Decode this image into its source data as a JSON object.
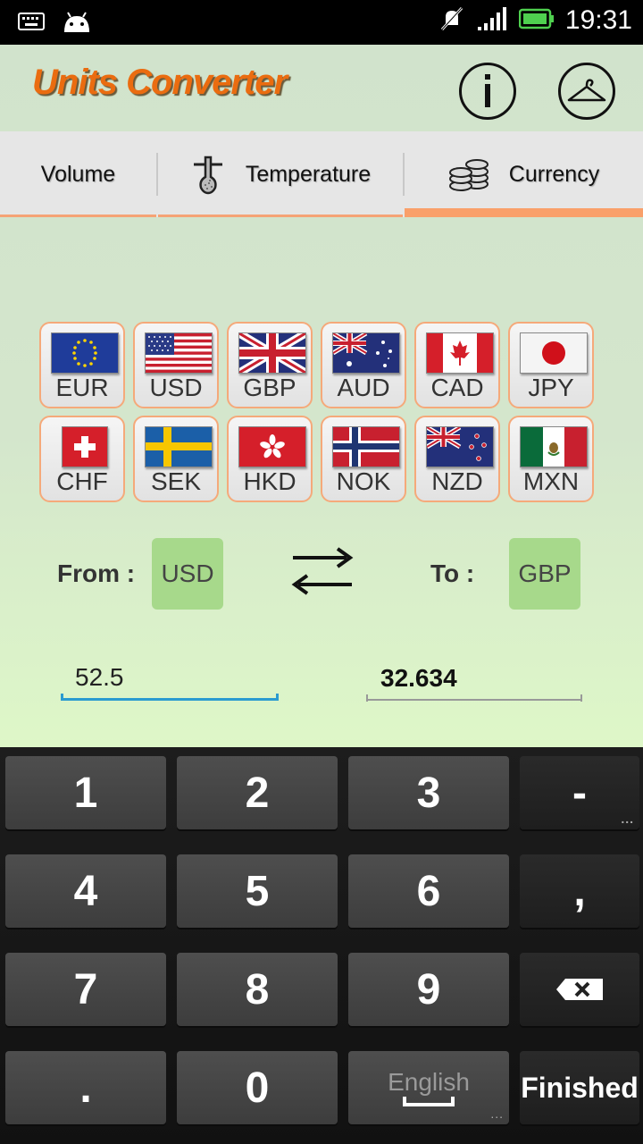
{
  "status_bar": {
    "time": "19:31",
    "left_icons": [
      "keyboard-icon",
      "android-icon"
    ],
    "right_icons": [
      "muted-bell-icon",
      "signal-icon",
      "battery-icon"
    ]
  },
  "app": {
    "title": "Units Converter",
    "info_button": "info-icon",
    "theme_button": "hanger-icon"
  },
  "tabs": [
    {
      "label": "Volume",
      "active": false
    },
    {
      "label": "Temperature",
      "active": false,
      "icon": "thermometer-icon"
    },
    {
      "label": "Currency",
      "active": true,
      "icon": "coins-icon"
    }
  ],
  "currencies": [
    {
      "code": "EUR"
    },
    {
      "code": "USD"
    },
    {
      "code": "GBP"
    },
    {
      "code": "AUD"
    },
    {
      "code": "CAD"
    },
    {
      "code": "JPY"
    },
    {
      "code": "CHF"
    },
    {
      "code": "SEK"
    },
    {
      "code": "HKD"
    },
    {
      "code": "NOK"
    },
    {
      "code": "NZD"
    },
    {
      "code": "MXN"
    }
  ],
  "converter": {
    "from_label": "From :",
    "from_value": "USD",
    "to_label": "To :",
    "to_value": "GBP",
    "amount": "52.5",
    "result": "32.634"
  },
  "colors": {
    "accent": "#ea6c10",
    "selected_currency": "#a7d98b",
    "input_underline": "#2b9bd0"
  },
  "keyboard": {
    "rows": [
      [
        "1",
        "2",
        "3",
        "-"
      ],
      [
        "4",
        "5",
        "6",
        ","
      ],
      [
        "7",
        "8",
        "9",
        "backspace"
      ],
      [
        ".",
        "0",
        "English",
        "Finished"
      ]
    ]
  }
}
